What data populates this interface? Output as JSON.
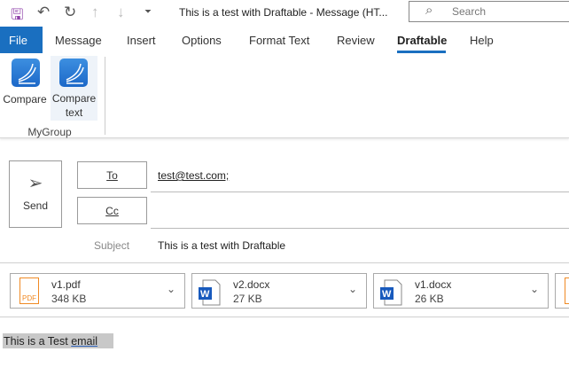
{
  "titlebar": {
    "title": "This is a test with Draftable  -  Message (HT...",
    "search_placeholder": "Search"
  },
  "tabs": [
    "File",
    "Message",
    "Insert",
    "Options",
    "Format Text",
    "Review",
    "Draftable",
    "Help"
  ],
  "active_tab": "Draftable",
  "ribbon": {
    "compare": "Compare",
    "compare_text_1": "Compare",
    "compare_text_2": "text",
    "group": "MyGroup"
  },
  "compose": {
    "send": "Send",
    "to_label": "To",
    "cc_label": "Cc",
    "to_value": "test@test.com;",
    "subject_label": "Subject",
    "subject_value": "This is a test with Draftable"
  },
  "attachments": [
    {
      "name": "v1.pdf",
      "size": "348 KB",
      "type": "pdf"
    },
    {
      "name": "v2.docx",
      "size": "27 KB",
      "type": "word"
    },
    {
      "name": "v1.docx",
      "size": "26 KB",
      "type": "word"
    }
  ],
  "body": {
    "text_plain": "This is a Test ",
    "text_link": "email"
  },
  "colors": {
    "accent": "#1a6fc0",
    "pdf": "#f08a24",
    "word": "#185abd"
  }
}
